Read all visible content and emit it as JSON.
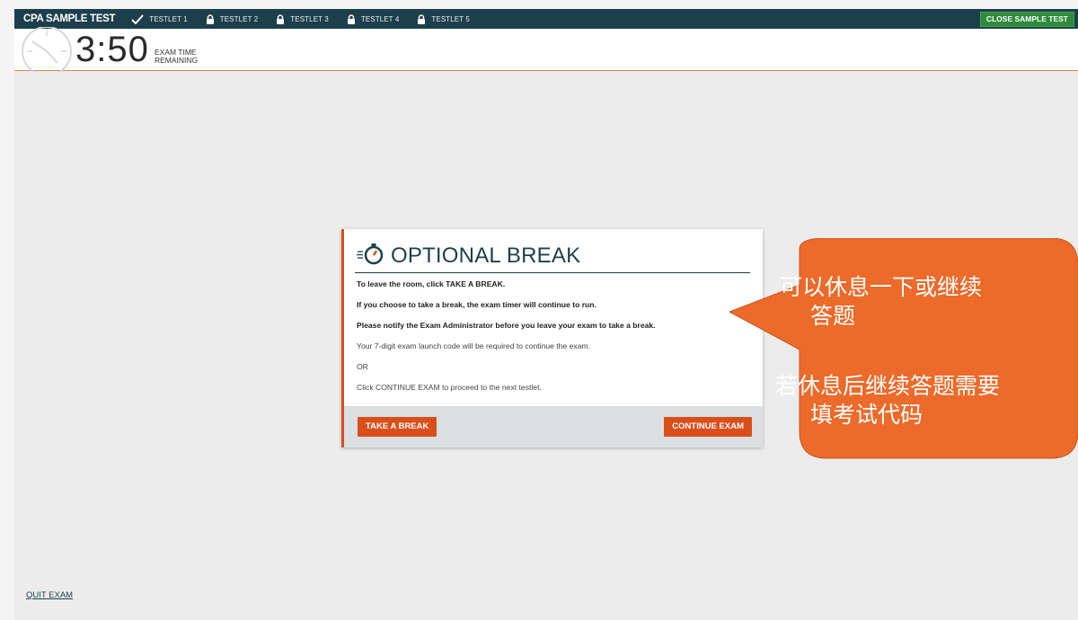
{
  "topnav": {
    "brand": "CPA SAMPLE TEST",
    "tabs": [
      {
        "label": "TESTLET 1",
        "icon": "checkmark-icon"
      },
      {
        "label": "TESTLET 2",
        "icon": "lock-icon"
      },
      {
        "label": "TESTLET 3",
        "icon": "lock-icon"
      },
      {
        "label": "TESTLET 4",
        "icon": "lock-icon"
      },
      {
        "label": "TESTLET 5",
        "icon": "lock-icon"
      }
    ],
    "close_label": "CLOSE SAMPLE TEST"
  },
  "timer": {
    "value": "3:50",
    "label_line1": "EXAM TIME",
    "label_line2": "REMAINING"
  },
  "dialog": {
    "icon": "stopwatch-icon",
    "title": "OPTIONAL BREAK",
    "lines": [
      "To leave the room, click TAKE A BREAK.",
      "If you choose to take a break, the exam timer will continue to run.",
      "Please notify the Exam Administrator before you leave your exam to take a break.",
      "Your 7-digit exam launch code will be required to continue the exam.",
      "OR",
      "Click CONTINUE EXAM to proceed to the next testlet."
    ],
    "take_break_label": "TAKE A BREAK",
    "continue_label": "CONTINUE EXAM"
  },
  "callout": {
    "line1": "可以休息一下或继续",
    "line2": "答题",
    "line3": "若休息后继续答题需要",
    "line4": "填考试代码"
  },
  "quit_label": "QUIT EXAM",
  "colors": {
    "navy": "#1d3f4c",
    "accent_orange": "#d94f1c",
    "callout_orange": "#ec6a2a",
    "close_green": "#2e8b3c"
  }
}
